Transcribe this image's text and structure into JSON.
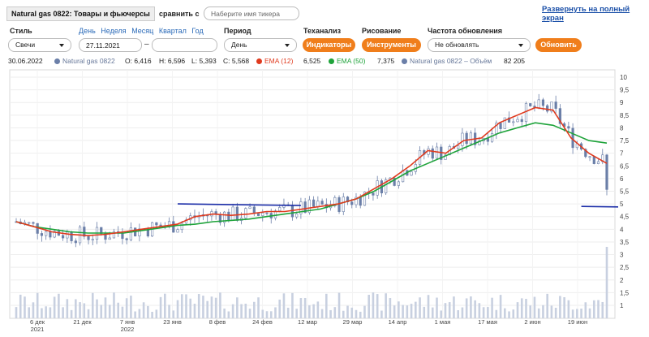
{
  "header": {
    "title": "Natural gas 0822: Товары и фьючерсы",
    "compare_label": "сравнить с",
    "compare_placeholder": "Наберите имя тикера",
    "fullscreen_link": "Развернуть на полный экран"
  },
  "controls": {
    "style_label": "Стиль",
    "style_value": "Свечи",
    "period_links": [
      "День",
      "Неделя",
      "Месяц",
      "Квартал",
      "Год"
    ],
    "date_from": "27.11.2021",
    "date_dash": "–",
    "date_to": "",
    "period_label": "Период",
    "period_value": "День",
    "techanalysis_label": "Теханализ",
    "indicators_button": "Индикаторы",
    "drawing_label": "Рисование",
    "tools_button": "Инструменты",
    "refresh_freq_label": "Частота обновления",
    "refresh_freq_value": "Не обновлять",
    "refresh_button": "Обновить"
  },
  "legend": {
    "date": "30.06.2022",
    "series_name": "Natural gas 0822",
    "o": "O: 6,416",
    "h": "H: 6,596",
    "l": "L: 5,393",
    "c": "C: 5,568",
    "ema12_label": "EMA (12)",
    "ema12_value": "6,525",
    "ema50_label": "EMA (50)",
    "ema50_value": "7,375",
    "volume_label": "Natural gas 0822 – Объём",
    "volume_value": "82 205"
  },
  "colors": {
    "series": "#6b7fa8",
    "ema12": "#e03a1e",
    "ema50": "#1ea33a",
    "volume": "#8898b8",
    "trendline": "#1c2ea8",
    "button": "#f07e1b",
    "link": "#1a4fa8"
  },
  "chart_data": {
    "type": "candlestick",
    "y_ticks": [
      "10",
      "9,5",
      "9",
      "8,5",
      "8",
      "7,5",
      "7",
      "6,5",
      "6",
      "5,5",
      "5",
      "4,5",
      "4",
      "3,5",
      "3",
      "2,5",
      "2",
      "1,5",
      "1"
    ],
    "ylim": [
      1,
      10
    ],
    "x_ticks": [
      "6 дек\n2021",
      "21 дек",
      "7 янв\n2022",
      "23 янв",
      "8 фев",
      "24 фев",
      "12 мар",
      "29 мар",
      "14 апр",
      "1 мая",
      "17 мая",
      "2 июн",
      "19 июн"
    ],
    "ema12": [
      4.3,
      4.1,
      3.9,
      3.8,
      3.75,
      3.8,
      3.9,
      4.0,
      4.1,
      4.2,
      4.5,
      4.6,
      4.55,
      4.6,
      4.7,
      4.7,
      4.8,
      4.9,
      5.0,
      5.2,
      5.6,
      6.0,
      6.5,
      7.1,
      7.0,
      7.5,
      7.6,
      8.2,
      8.5,
      8.8,
      8.7,
      7.6,
      7.0,
      6.6
    ],
    "ema50": [
      4.3,
      4.1,
      4.0,
      3.9,
      3.85,
      3.85,
      3.85,
      3.95,
      4.05,
      4.15,
      4.2,
      4.3,
      4.35,
      4.4,
      4.5,
      4.6,
      4.7,
      4.8,
      5.0,
      5.2,
      5.5,
      5.9,
      6.3,
      6.6,
      6.9,
      7.2,
      7.5,
      7.8,
      8.0,
      8.2,
      8.1,
      7.8,
      7.5,
      7.4
    ],
    "trendline_level": 5.0,
    "last_close": 5.568,
    "last_volume": 82205
  }
}
